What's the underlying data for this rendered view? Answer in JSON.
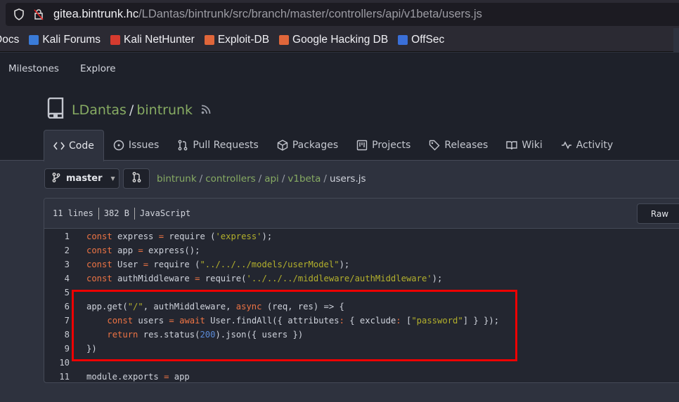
{
  "browser": {
    "url_host": "gitea.bintrunk.hc",
    "url_path": "/LDantas/bintrunk/src/branch/master/controllers/api/v1beta/users.js",
    "bookmarks": [
      {
        "label": "Docs",
        "color": "#3a6fd8"
      },
      {
        "label": "Kali Forums",
        "color": "#3a7bd8"
      },
      {
        "label": "Kali NetHunter",
        "color": "#d63b2f"
      },
      {
        "label": "Exploit-DB",
        "color": "#e0663a"
      },
      {
        "label": "Google Hacking DB",
        "color": "#e0663a"
      },
      {
        "label": "OffSec",
        "color": "#3a6fd8"
      }
    ]
  },
  "nav": {
    "items": [
      "Milestones",
      "Explore"
    ]
  },
  "repo": {
    "owner": "LDantas",
    "sep": "/",
    "name": "bintrunk",
    "tabs": [
      {
        "label": "Code",
        "icon": "code-icon"
      },
      {
        "label": "Issues",
        "icon": "issue-icon"
      },
      {
        "label": "Pull Requests",
        "icon": "pull-request-icon"
      },
      {
        "label": "Packages",
        "icon": "package-icon"
      },
      {
        "label": "Projects",
        "icon": "project-icon"
      },
      {
        "label": "Releases",
        "icon": "tag-icon"
      },
      {
        "label": "Wiki",
        "icon": "book-icon"
      },
      {
        "label": "Activity",
        "icon": "pulse-icon"
      }
    ]
  },
  "branch": "master",
  "breadcrumb": [
    "bintrunk",
    "controllers",
    "api",
    "v1beta",
    "users.js"
  ],
  "file": {
    "lines": "11 lines",
    "size": "382 B",
    "language": "JavaScript",
    "raw_label": "Raw",
    "code": [
      [
        [
          "kw",
          "const"
        ],
        [
          "tx",
          " express "
        ],
        [
          "kw",
          "="
        ],
        [
          "tx",
          " require ("
        ],
        [
          "str",
          "'express'"
        ],
        [
          "tx",
          ");"
        ]
      ],
      [
        [
          "kw",
          "const"
        ],
        [
          "tx",
          " app "
        ],
        [
          "kw",
          "="
        ],
        [
          "tx",
          " express();"
        ]
      ],
      [
        [
          "kw",
          "const"
        ],
        [
          "tx",
          " User "
        ],
        [
          "kw",
          "="
        ],
        [
          "tx",
          " require ("
        ],
        [
          "str",
          "\"../../../models/userModel\""
        ],
        [
          "tx",
          ");"
        ]
      ],
      [
        [
          "kw",
          "const"
        ],
        [
          "tx",
          " authMiddleware "
        ],
        [
          "kw",
          "="
        ],
        [
          "tx",
          " require("
        ],
        [
          "str",
          "'../../../middleware/authMiddleware'"
        ],
        [
          "tx",
          ");"
        ]
      ],
      [],
      [
        [
          "tx",
          "app.get("
        ],
        [
          "str",
          "\"/\""
        ],
        [
          "tx",
          ", authMiddleware, "
        ],
        [
          "kw",
          "async"
        ],
        [
          "tx",
          " (req, res) => {"
        ]
      ],
      [
        [
          "tx",
          "    "
        ],
        [
          "kw",
          "const"
        ],
        [
          "tx",
          " users "
        ],
        [
          "kw",
          "="
        ],
        [
          "tx",
          " "
        ],
        [
          "kw",
          "await"
        ],
        [
          "tx",
          " User.findAll({ attributes"
        ],
        [
          "kw",
          ":"
        ],
        [
          "tx",
          " { exclude"
        ],
        [
          "kw",
          ":"
        ],
        [
          "tx",
          " ["
        ],
        [
          "str",
          "\"password\""
        ],
        [
          "tx",
          "] } });"
        ]
      ],
      [
        [
          "tx",
          "    "
        ],
        [
          "kw",
          "return"
        ],
        [
          "tx",
          " res.status("
        ],
        [
          "nm",
          "200"
        ],
        [
          "tx",
          ").json({ users })"
        ]
      ],
      [
        [
          "tx",
          "})"
        ]
      ],
      [],
      [
        [
          "tx",
          "module.exports "
        ],
        [
          "kw",
          "="
        ],
        [
          "tx",
          " app"
        ]
      ]
    ]
  },
  "colors": {
    "highlight": "#ee0000",
    "link": "#87ab63"
  }
}
